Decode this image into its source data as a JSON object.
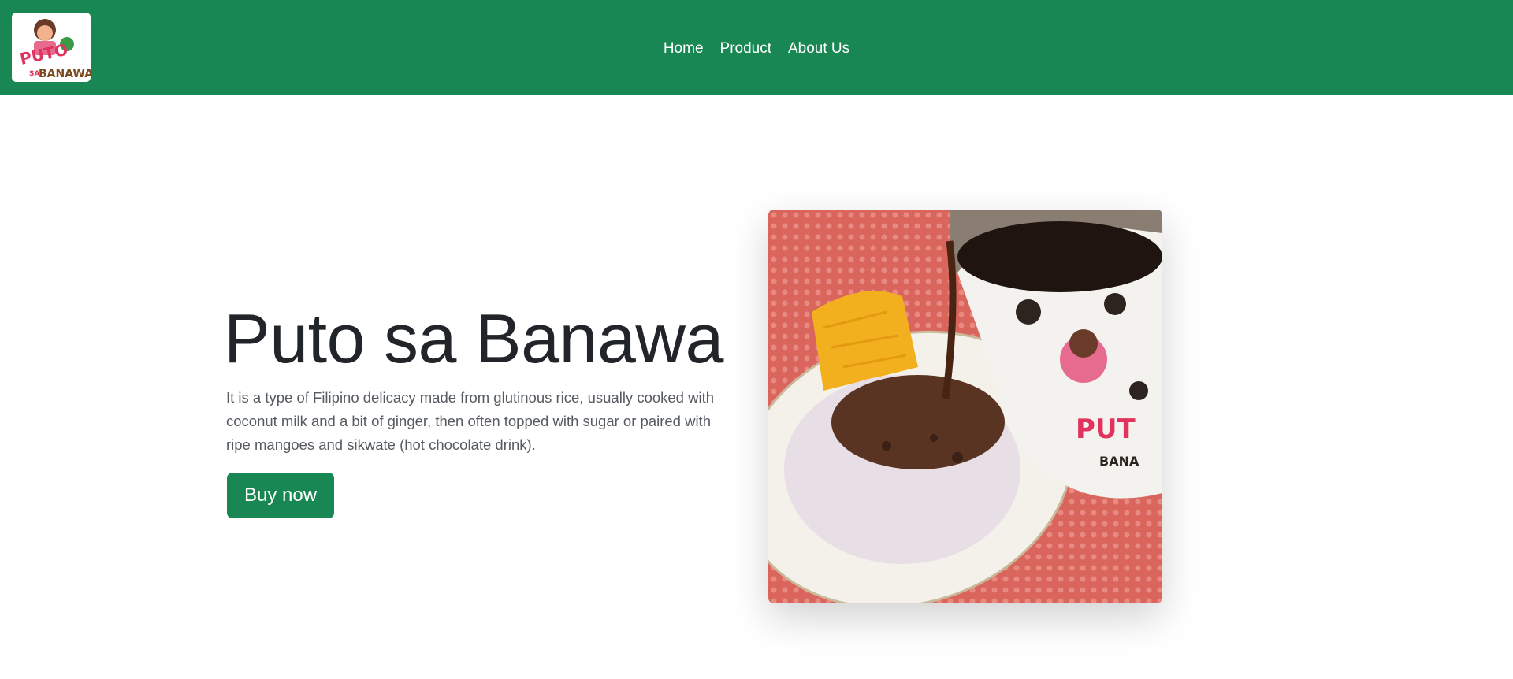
{
  "nav": {
    "logo_text": "PUTO SA BANAWA",
    "links": [
      {
        "label": "Home"
      },
      {
        "label": "Product"
      },
      {
        "label": "About Us"
      }
    ]
  },
  "hero": {
    "title": "Puto sa Banawa",
    "description": "It is a type of Filipino delicacy made from glutinous rice, usually cooked with coconut milk and a bit of ginger, then often topped with sugar or paired with ripe mangoes and sikwate (hot chocolate drink).",
    "button_label": "Buy now"
  },
  "colors": {
    "brand_green": "#198754",
    "text_dark": "#212529",
    "text_muted": "#555b61"
  }
}
